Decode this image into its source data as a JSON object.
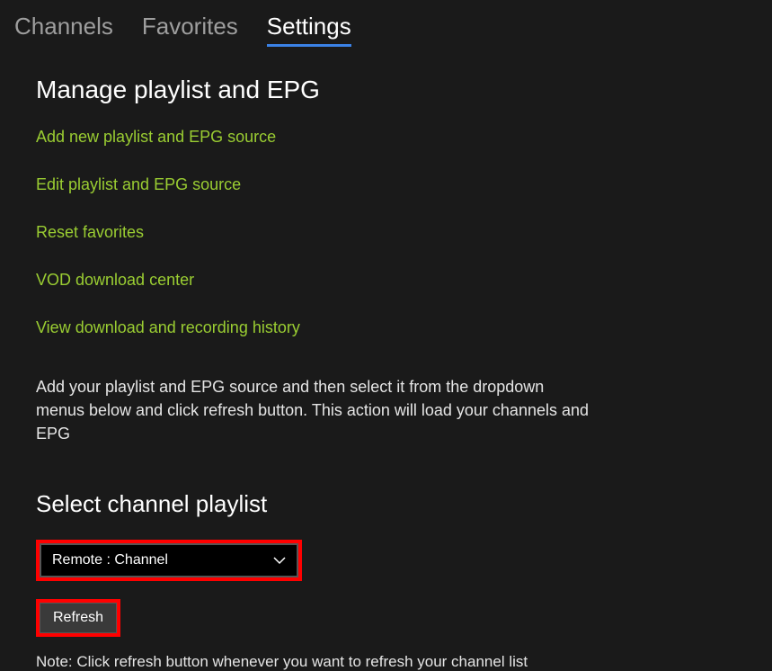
{
  "tabs": {
    "channels": "Channels",
    "favorites": "Favorites",
    "settings": "Settings"
  },
  "section": {
    "title": "Manage playlist and EPG",
    "links": {
      "add_source": "Add new playlist and EPG source",
      "edit_source": "Edit playlist and EPG source",
      "reset_favorites": "Reset favorites",
      "vod_center": "VOD download center",
      "view_history": "View download and recording history"
    },
    "description": "Add your playlist and EPG source and then select it from the dropdown menus below and click refresh button. This action will load your channels and EPG"
  },
  "select_playlist": {
    "title": "Select channel playlist",
    "dropdown_value": "Remote : Channel",
    "refresh_label": "Refresh",
    "note": "Note: Click refresh button whenever you want to refresh your channel list"
  },
  "highlight_color": "#ff0000",
  "accent_color": "#3b82e6",
  "link_color": "#9acd32"
}
